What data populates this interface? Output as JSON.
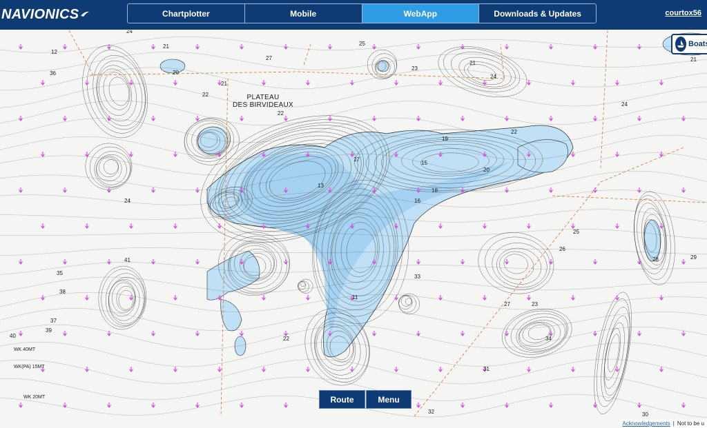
{
  "app": {
    "logo": "NAVIONICS"
  },
  "nav": {
    "tabs": [
      {
        "label": "Chartplotter",
        "active": false
      },
      {
        "label": "Mobile",
        "active": false
      },
      {
        "label": "WebApp",
        "active": true
      },
      {
        "label": "Downloads & Updates",
        "active": false
      }
    ]
  },
  "user": {
    "name": "courtox56"
  },
  "map": {
    "area_label_line1": "PLATEAU",
    "area_label_line2": "DES BIRVIDEAUX",
    "shallow_color": "#b8dcf3",
    "contour_color": "#2b2b2b",
    "marker_color": "#e040e0",
    "depth_soundings": [
      "24",
      "21",
      "20",
      "22",
      "21",
      "27",
      "22",
      "25",
      "23",
      "21",
      "24",
      "23",
      "24",
      "21",
      "22",
      "20",
      "19",
      "15",
      "16",
      "18",
      "17",
      "13",
      "11",
      "12",
      "36",
      "35",
      "38",
      "37",
      "39",
      "40",
      "41",
      "30",
      "32",
      "31",
      "34",
      "26",
      "28",
      "29",
      "33",
      "24",
      "22",
      "27",
      "25"
    ],
    "wreck_labels": [
      "WK 40MT",
      "WK(PA) 15MT",
      "WK 20MT"
    ]
  },
  "widgets": {
    "boats_label": "Boats"
  },
  "buttons": {
    "route": "Route",
    "menu": "Menu"
  },
  "footer": {
    "acknowledgements": "Acknowledgements",
    "disclaimer": "Not to be u"
  },
  "colors": {
    "header_bg": "#0e3b73",
    "tab_active": "#2f9ce6",
    "accent": "#2f9ce6"
  }
}
